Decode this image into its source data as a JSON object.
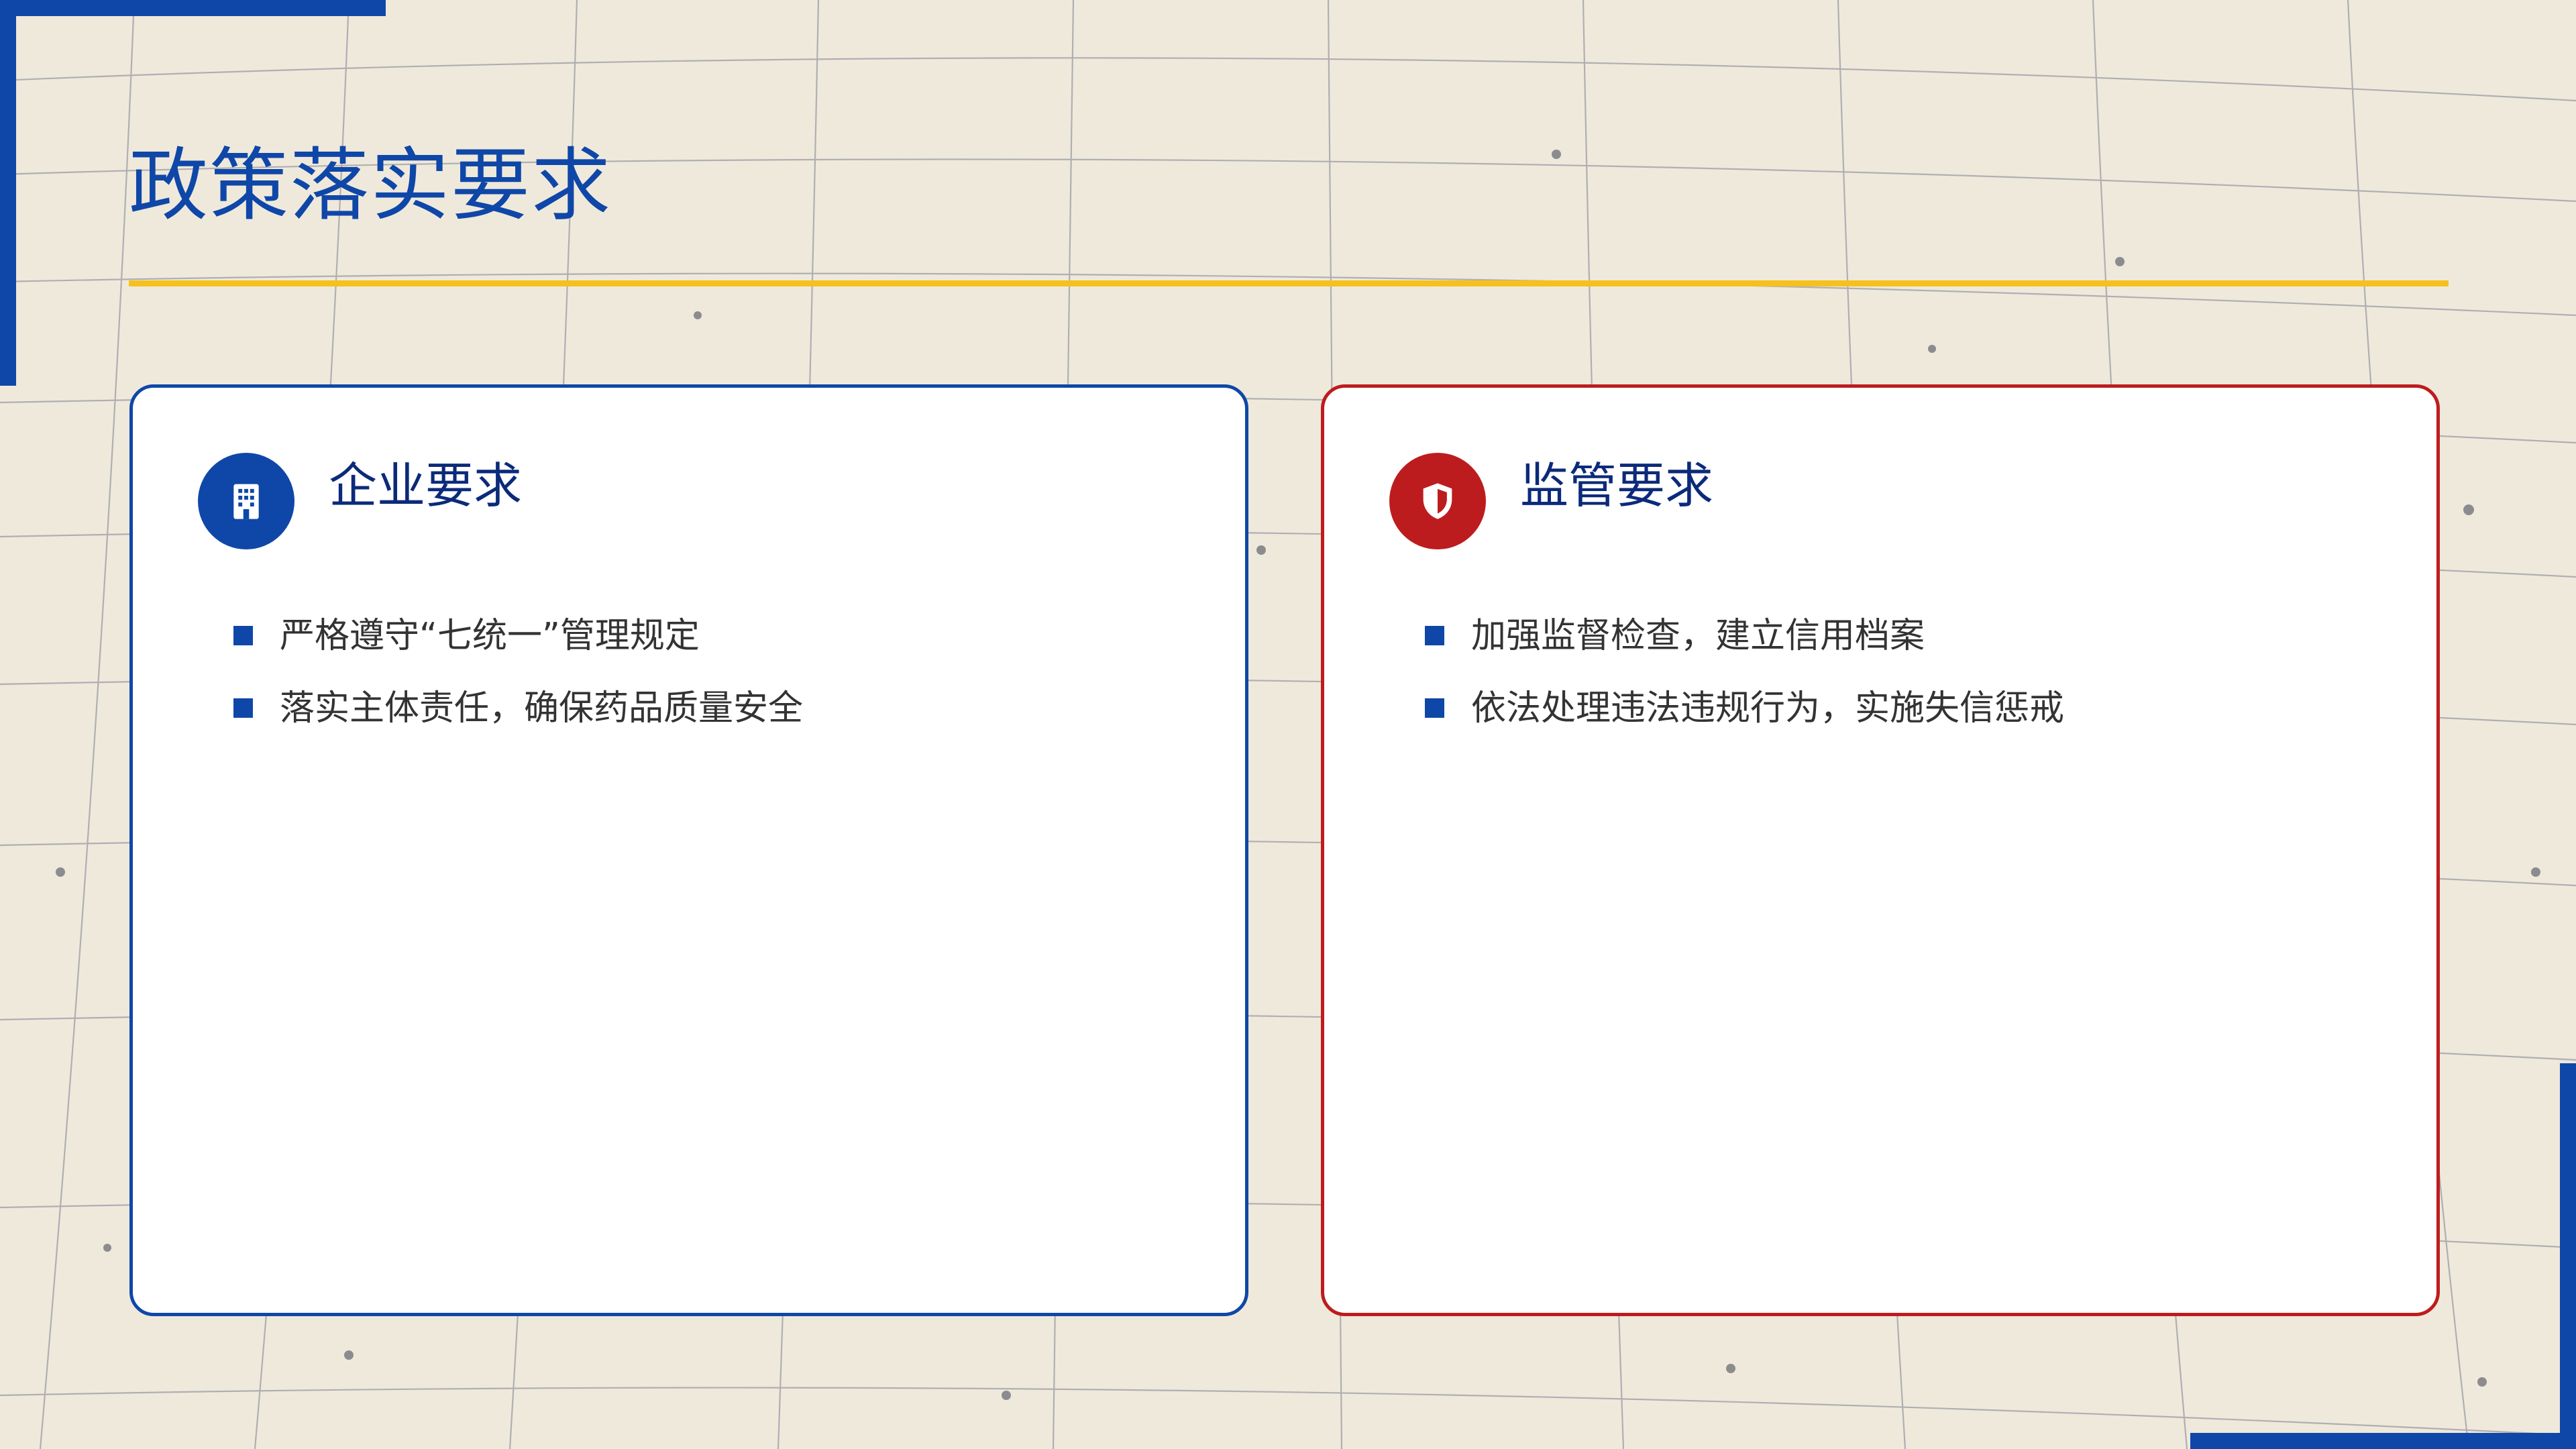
{
  "slide": {
    "title": "政策落实要求"
  },
  "cards": [
    {
      "title": "企业要求",
      "icon": "building-icon",
      "accent": "#0f47a8",
      "items": [
        "严格遵守“七统一”管理规定",
        "落实主体责任，确保药品质量安全"
      ]
    },
    {
      "title": "监管要求",
      "icon": "shield-icon",
      "accent": "#bd1c1e",
      "items": [
        "加强监督检查，建立信用档案",
        "依法处理违法违规行为，实施失信惩戒"
      ]
    }
  ],
  "colors": {
    "primary_blue": "#0f47a8",
    "accent_red": "#bd1c1e",
    "rule_yellow": "#f6c11c",
    "heading_navy": "#0c2a7a",
    "body_text": "#333333",
    "background": "#efe9dc"
  }
}
